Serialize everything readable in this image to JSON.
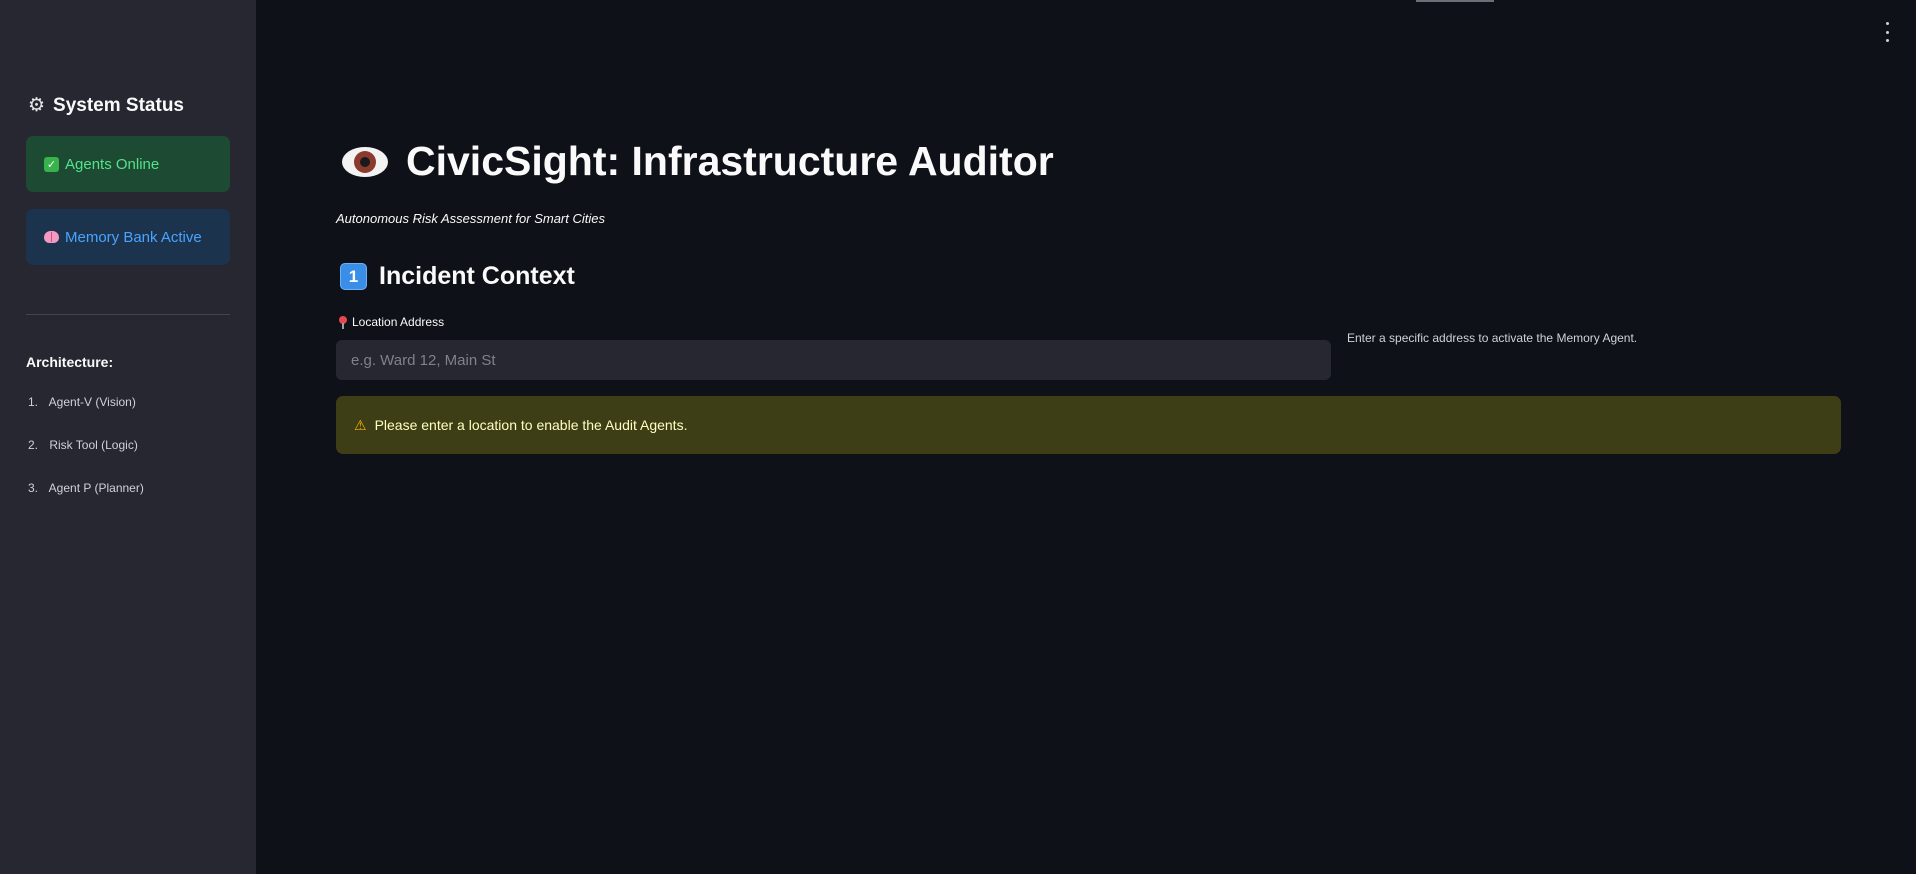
{
  "sidebar": {
    "status_title": "System Status",
    "status_icon": "gear-icon",
    "agents_status": "Agents Online",
    "memory_status": "Memory Bank Active",
    "architecture_title": "Architecture:",
    "architecture_items": [
      {
        "num": "1.",
        "label": "Agent-V (Vision)"
      },
      {
        "num": "2.",
        "label": "Risk Tool (Logic)"
      },
      {
        "num": "3.",
        "label": "Agent P (Planner)"
      }
    ]
  },
  "header": {
    "title": "CivicSight: Infrastructure Auditor",
    "subtitle": "Autonomous Risk Assessment for Smart Cities"
  },
  "section": {
    "number": "1",
    "title": "Incident Context"
  },
  "location": {
    "label": "Location Address",
    "placeholder": "e.g. Ward 12, Main St",
    "value": "",
    "help": "Enter a specific address to activate the Memory Agent."
  },
  "warning": {
    "text": "Please enter a location to enable the Audit Agents."
  },
  "colors": {
    "background": "#0e1117",
    "sidebar": "#262730",
    "success_bg": "#1d4a33",
    "success_text": "#54e28a",
    "info_bg": "#1c334d",
    "info_text": "#4aa3ff",
    "warning_bg": "#3e3e16",
    "warning_text": "#ffffc2"
  }
}
